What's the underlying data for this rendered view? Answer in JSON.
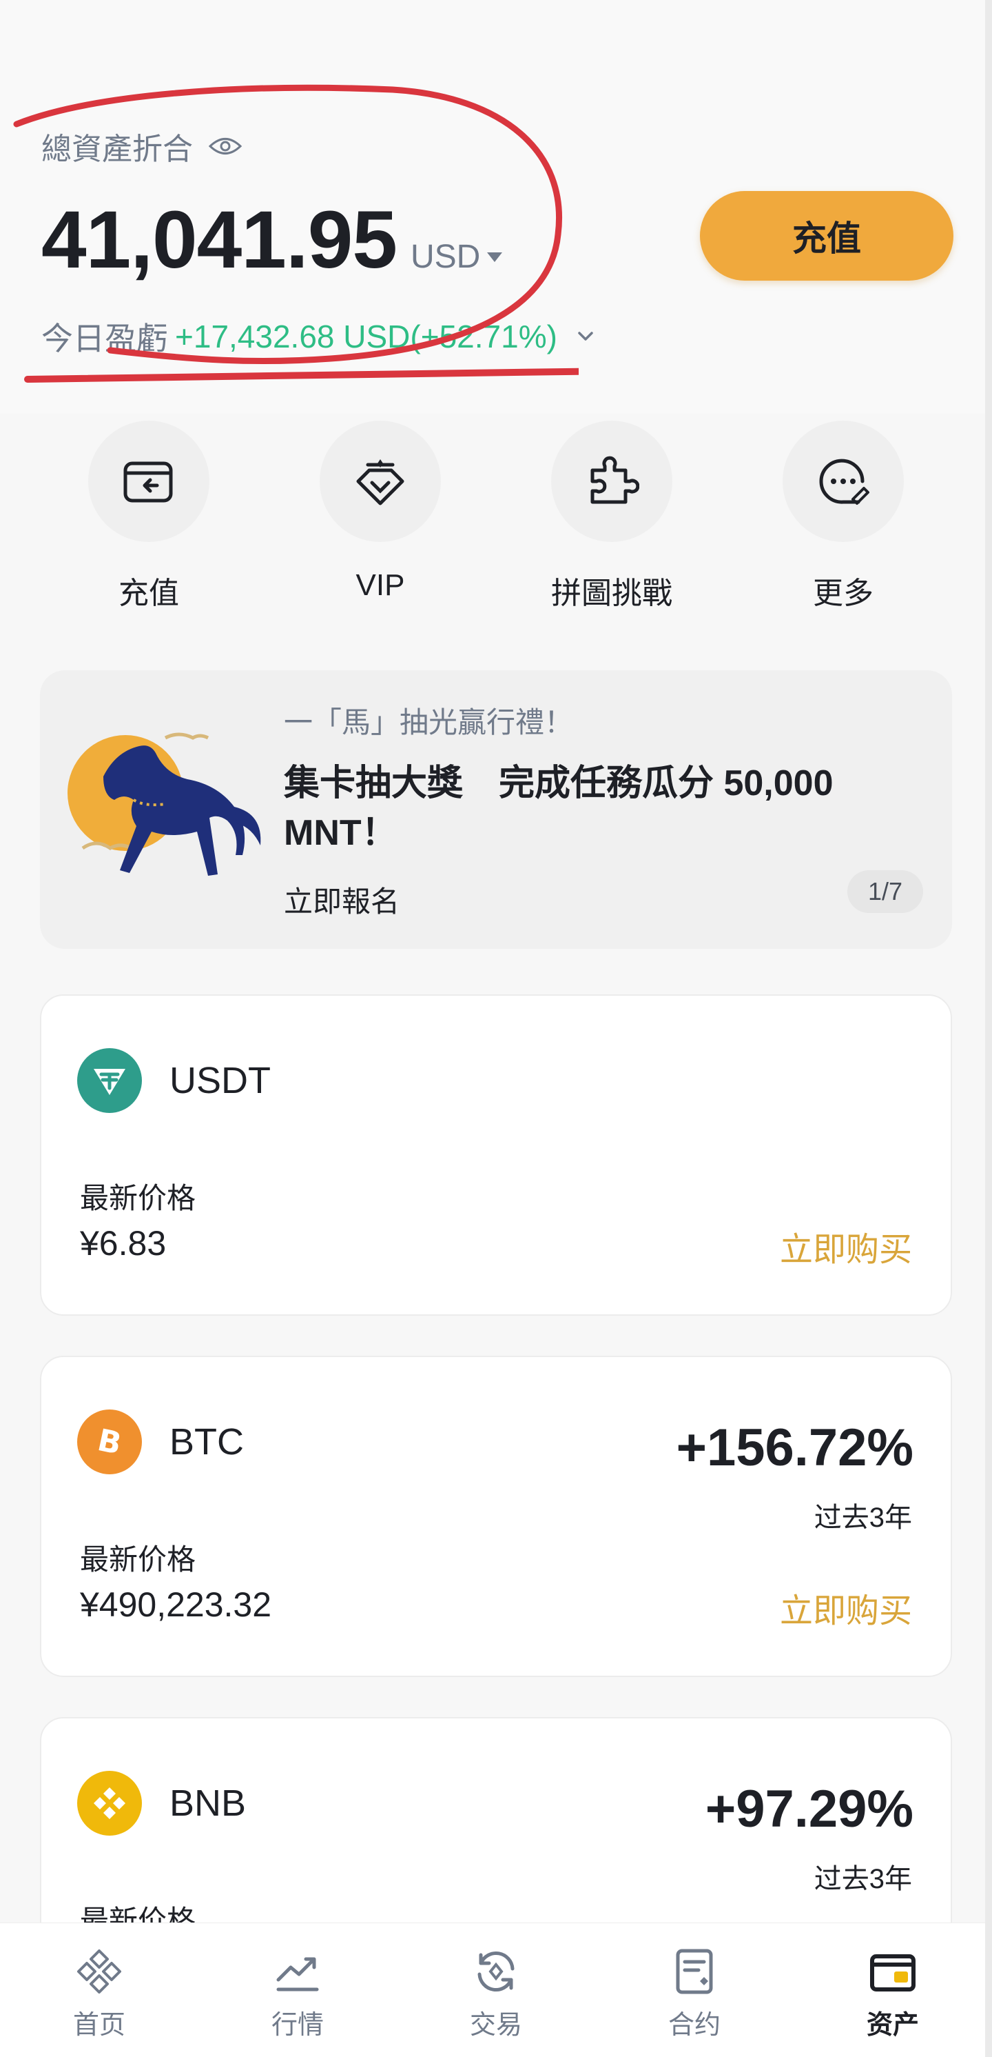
{
  "header": {
    "balance_label": "總資產折合",
    "balance_value": "41,041.95",
    "currency": "USD",
    "pnl_label": "今日盈虧",
    "pnl_value": "+17,432.68 USD(+52.71%)",
    "deposit_label": "充值"
  },
  "quick_actions": [
    {
      "label": "充值",
      "icon": "deposit-icon"
    },
    {
      "label": "VIP",
      "icon": "vip-icon"
    },
    {
      "label": "拼圖挑戰",
      "icon": "puzzle-icon"
    },
    {
      "label": "更多",
      "icon": "more-icon"
    }
  ],
  "banner": {
    "subtitle": "一「馬」抽光贏行禮！",
    "title": "集卡抽大獎　完成任務瓜分 50,000 MNT！",
    "cta": "立即報名",
    "page_indicator": "1/7"
  },
  "coins": [
    {
      "symbol": "USDT",
      "price_label": "最新价格",
      "price": "¥6.83",
      "buy_label": "立即购买",
      "change": "",
      "period": "",
      "color": "#2e9d8b"
    },
    {
      "symbol": "BTC",
      "price_label": "最新价格",
      "price": "¥490,223.32",
      "buy_label": "立即购买",
      "change": "+156.72%",
      "period": "过去3年",
      "color": "#f0902e"
    },
    {
      "symbol": "BNB",
      "price_label": "最新价格",
      "price": "",
      "buy_label": "",
      "change": "+97.29%",
      "period": "过去3年",
      "color": "#f0b90b"
    }
  ],
  "nav": [
    {
      "label": "首页",
      "icon": "home-icon"
    },
    {
      "label": "行情",
      "icon": "markets-icon"
    },
    {
      "label": "交易",
      "icon": "trade-icon"
    },
    {
      "label": "合约",
      "icon": "futures-icon"
    },
    {
      "label": "资产",
      "icon": "assets-icon",
      "active": true
    }
  ],
  "colors": {
    "accent": "#f0a93d",
    "positive": "#2ebd85",
    "buy_link": "#d9a53a",
    "annotation": "#d9363e"
  }
}
